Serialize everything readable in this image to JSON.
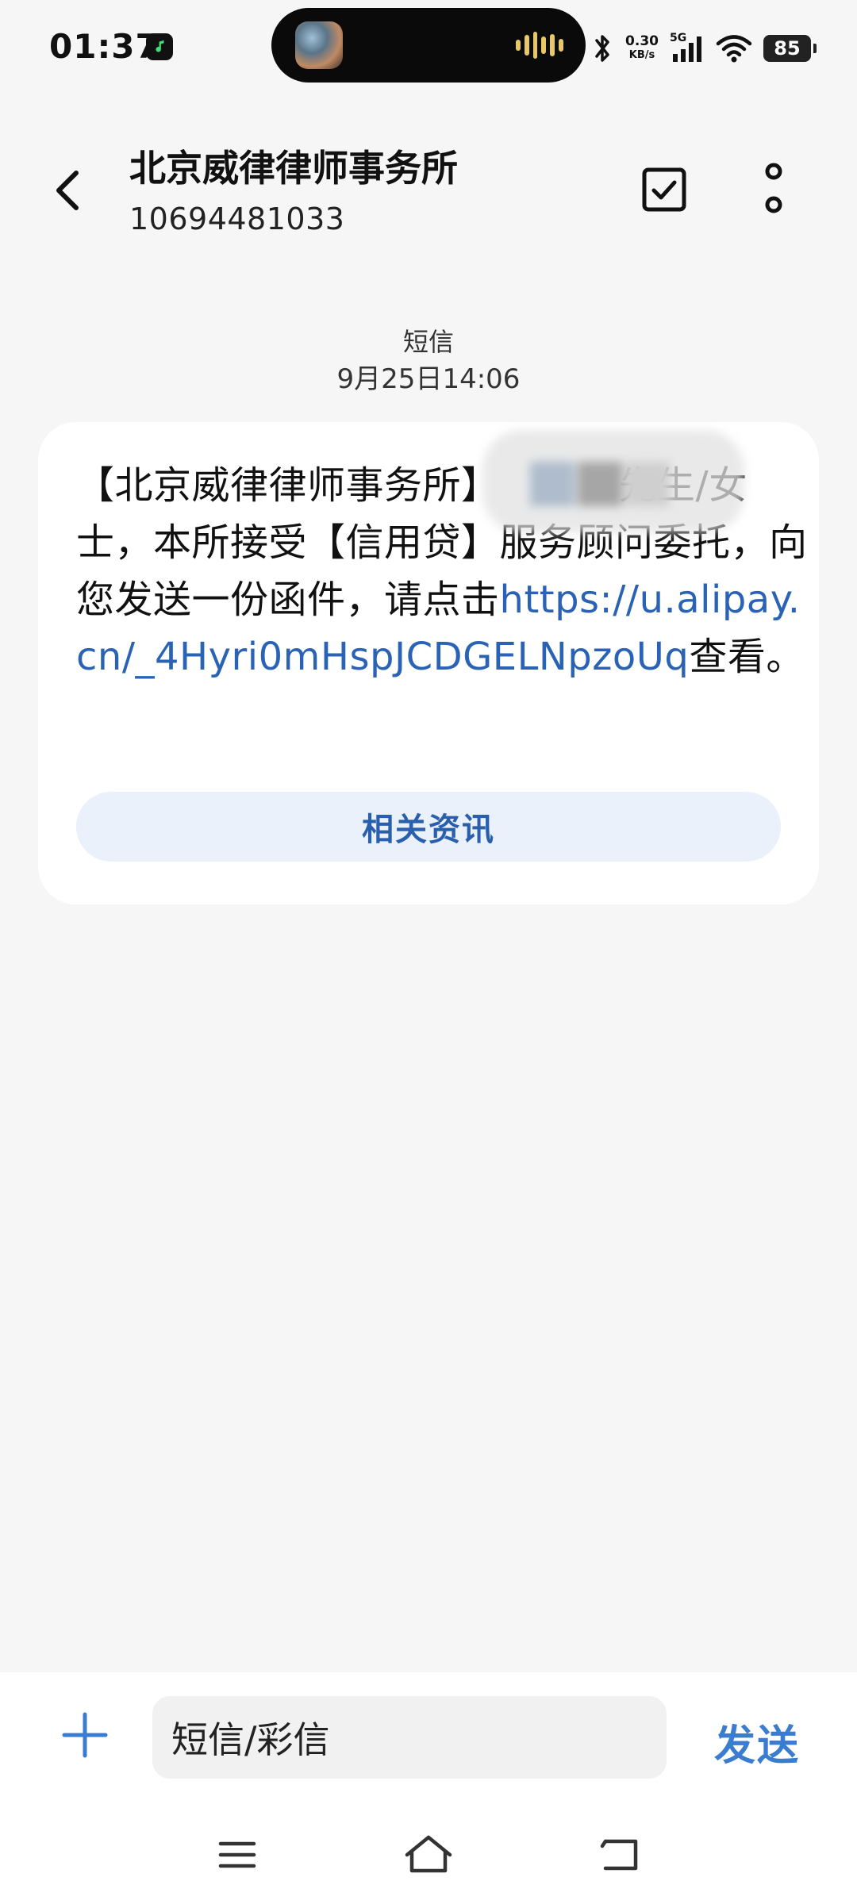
{
  "status_bar": {
    "time": "01:37",
    "net_speed_value": "0.30",
    "net_speed_unit": "KB/s",
    "network_type": "5G",
    "battery": "85"
  },
  "header": {
    "contact_name": "北京威律律师事务所",
    "contact_number": "10694481033"
  },
  "message": {
    "type": "短信",
    "date": "9月25日14:06",
    "text_line1": "【北京威律律师事务所】",
    "text_redacted_suffix": "先生/女士，本所接受【信用贷】服务顾问委托，向您发送一份函件，请点击",
    "link": "https://u.alipay.cn/_4Hyri0mHspJCDGELNpzoUq",
    "text_end": "查看。",
    "related_button": "相关资讯"
  },
  "compose": {
    "placeholder": "短信/彩信",
    "send_label": "发送"
  },
  "icons": {
    "back": "chevron-left-icon",
    "select": "checkbox-icon",
    "more": "more-vertical-icon",
    "plus": "plus-icon",
    "menu": "menu-icon",
    "home": "home-icon",
    "nav_back": "back-icon",
    "bluetooth": "bluetooth-icon",
    "wifi": "wifi-icon",
    "signal": "signal-icon",
    "music": "music-icon"
  },
  "colors": {
    "link": "#2a63b5",
    "accent": "#3a7cd0",
    "background": "#f6f6f6",
    "bubble": "#ffffff",
    "related_button_bg": "#eaf1fb"
  }
}
